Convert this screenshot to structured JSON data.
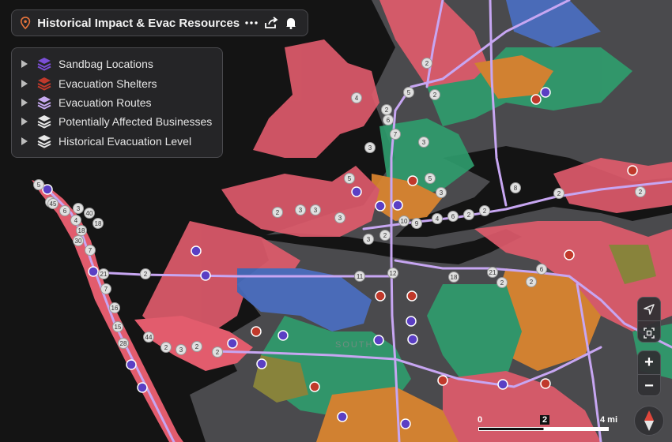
{
  "header": {
    "title": "Historical Impact & Evac Resources",
    "icons": [
      "map-pin-icon",
      "more-horizontal-icon",
      "share-icon",
      "bell-icon"
    ]
  },
  "layers": [
    {
      "name": "Sandbag Locations",
      "icon": "stack-purple-icon",
      "color": "#7b4fd6"
    },
    {
      "name": "Evacuation Shelters",
      "icon": "stack-red-icon",
      "color": "#c0392b"
    },
    {
      "name": "Evacuation Routes",
      "icon": "stack-lilac-icon",
      "color": "#c6a9f0"
    },
    {
      "name": "Potentially Affected Businesses",
      "icon": "stack-white-icon",
      "color": "#e8e8e8"
    },
    {
      "name": "Historical Evacuation Level",
      "icon": "stack-white-icon",
      "color": "#e8e8e8"
    }
  ],
  "map": {
    "colors": {
      "water": "#141414",
      "land": "#4a4a4d",
      "zone_a": "#e25c6d",
      "zone_b": "#2f9e6e",
      "zone_c": "#e0882f",
      "zone_d": "#4b6fc4",
      "zone_e": "#8f8a3a",
      "route": "#c7a6f2",
      "sandbag": "#5b3fc4",
      "shelter": "#c0392b",
      "cluster": "#e0e0e0"
    },
    "cluster_labels": [
      "5",
      "2",
      "6",
      "3",
      "4",
      "45",
      "40",
      "18",
      "18",
      "30",
      "7",
      "7",
      "21",
      "15",
      "28",
      "16",
      "2",
      "2",
      "44",
      "2",
      "3",
      "2",
      "5",
      "11",
      "12",
      "18",
      "21",
      "2",
      "2",
      "6",
      "8",
      "2",
      "2",
      "3",
      "3",
      "3",
      "3",
      "4",
      "2",
      "7",
      "2",
      "10",
      "9",
      "2",
      "4",
      "3",
      "5",
      "3",
      "6",
      "2",
      "6",
      "2",
      "2",
      "5",
      "3",
      "2"
    ]
  },
  "zoom_controls": {
    "plus": "+",
    "minus": "−"
  },
  "scale": {
    "zero": "0",
    "mid": "2",
    "end": "4 mi"
  },
  "watermark": "SOUTH"
}
